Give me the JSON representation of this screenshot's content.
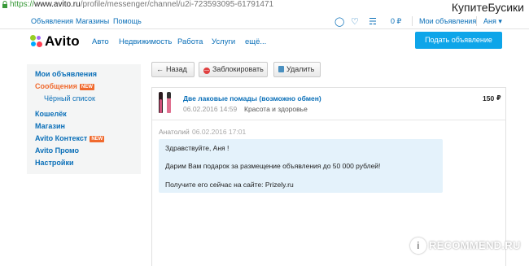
{
  "browser": {
    "url_scheme": "https://",
    "url_host": "www.avito.ru",
    "url_path": "/profile/messenger/channel/u2i-723593095-61791471"
  },
  "watermark_top": "КупитеБусики",
  "top_nav": {
    "announcements": "Объявления",
    "shops": "Магазины",
    "help": "Помощь",
    "balance": "0 ₽",
    "my_ads": "Мои объявления",
    "user": "Аня ▾"
  },
  "logo_text": "Avito",
  "categories": [
    "Авто",
    "Недвижимость",
    "Работа",
    "Услуги",
    "ещё..."
  ],
  "post_button": "Подать объявление",
  "sidebar": {
    "my_ads": "Мои объявления",
    "messages": "Сообщения",
    "messages_badge": "NEW",
    "blacklist": "Чёрный список",
    "wallet": "Кошелёк",
    "shop": "Магазин",
    "context": "Avito Контекст",
    "context_badge": "NEW",
    "promo": "Avito Промо",
    "settings": "Настройки"
  },
  "actions": {
    "back": "Назад",
    "block": "Заблокировать",
    "delete": "Удалить"
  },
  "item": {
    "title": "Две лаковые помады (возможно обмен)",
    "date": "06.02.2016 14:59",
    "category": "Красота и здоровье",
    "price": "150"
  },
  "message": {
    "author": "Анатолий",
    "date": "06.02.2016 17:01",
    "lines": [
      "Здравствуйте,  Аня  !",
      "Дарим Вам подарок за размещение объявления до 50 000 рублей!",
      "Получите его сейчас на сайте: Prizely.ru"
    ]
  },
  "watermark_bottom": "RECOMMEND.RU",
  "colors": {
    "link": "#0a6fb8",
    "accent_orange": "#f06a2e",
    "primary_button": "#0ea5e9",
    "bubble": "#e4f2fb",
    "sidebar_bg": "#f4f5f5"
  }
}
